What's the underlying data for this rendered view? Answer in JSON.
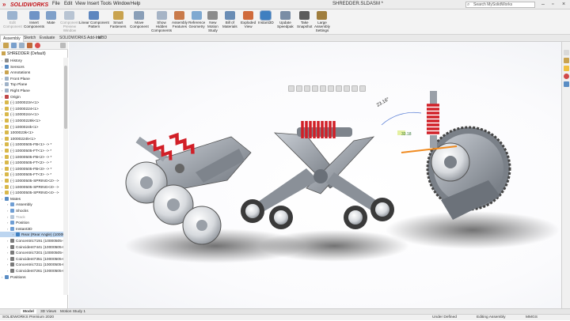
{
  "app": {
    "brand": "SOLIDWORKS",
    "doc_title": "SHREDDER.SLDASM *",
    "search_placeholder": "Search MySolidWorks"
  },
  "menu": [
    "File",
    "Edit",
    "View",
    "Insert",
    "Tools",
    "Window",
    "Help"
  ],
  "toolbar": [
    {
      "label": "Edit\nComponent",
      "dim": true,
      "color": "#9bb3cf"
    },
    {
      "label": "Insert\nComponents",
      "color": "#6f93c6"
    },
    {
      "label": "Mate",
      "color": "#7fa0c9"
    },
    {
      "label": "Component\nPreview\nWindow",
      "dim": true,
      "color": "#b8c4d3"
    },
    {
      "label": "Linear Component\nPattern",
      "color": "#5d86bf"
    },
    {
      "label": "Smart\nFasteners",
      "color": "#c9a34f"
    },
    {
      "label": "Move\nComponent",
      "color": "#8a9fb8"
    },
    {
      "label": "Show\nHidden\nComponents",
      "color": "#a6b4c6"
    },
    {
      "label": "Assembly\nFeatures",
      "color": "#c97a4a"
    },
    {
      "label": "Reference\nGeometry",
      "color": "#7fa9d1"
    },
    {
      "label": "New\nMotion\nStudy",
      "color": "#8c8c8c"
    },
    {
      "label": "Bill of\nMaterials",
      "color": "#6a8db5"
    },
    {
      "label": "Exploded\nView",
      "color": "#d06b3c"
    },
    {
      "label": "Instant3D",
      "active": true,
      "color": "#3f7fc0"
    },
    {
      "label": "Update\nSpeedpak",
      "color": "#7a8da5"
    },
    {
      "label": "Take\nSnapshot",
      "color": "#5c5c5c"
    },
    {
      "label": "Large\nAssembly\nSettings",
      "color": "#a07e3e"
    }
  ],
  "tabs": [
    "Assembly",
    "Sketch",
    "Evaluate",
    "SOLIDWORKS Add-Ins",
    "MBD"
  ],
  "tree": {
    "root": "SHREDDER (Default)",
    "items": [
      {
        "label": "History",
        "depth": 1,
        "icon": "#8c8c8c"
      },
      {
        "label": "Sensors",
        "depth": 1,
        "icon": "#5a8dc4"
      },
      {
        "label": "Annotations",
        "depth": 1,
        "icon": "#c9a34f"
      },
      {
        "label": "Front Plane",
        "depth": 1,
        "icon": "#9fb2c8"
      },
      {
        "label": "Top Plane",
        "depth": 1,
        "icon": "#9fb2c8"
      },
      {
        "label": "Right Plane",
        "depth": 1,
        "icon": "#9fb2c8"
      },
      {
        "label": "Origin",
        "depth": 1,
        "icon": "#c14848"
      },
      {
        "label": "(-) 1000023A<1>",
        "depth": 1,
        "icon": "#d9b84a"
      },
      {
        "label": "(-) 10000224<1>",
        "depth": 1,
        "icon": "#d9b84a"
      },
      {
        "label": "(-) 1000024A<1>",
        "depth": 1,
        "icon": "#d9b84a"
      },
      {
        "label": "(-) 10000228k<1>",
        "depth": 1,
        "icon": "#d9b84a"
      },
      {
        "label": "(-) 1000024k<1>",
        "depth": 1,
        "icon": "#d9b84a"
      },
      {
        "label": "1000023k<1>",
        "depth": 1,
        "icon": "#d9b84a"
      },
      {
        "label": "10000224k<1>",
        "depth": 1,
        "icon": "#d9b84a"
      },
      {
        "label": "(-) 10000505-FB<1> -> *",
        "depth": 1,
        "icon": "#d9b84a"
      },
      {
        "label": "(-) 10000505-FT<1> -> *",
        "depth": 1,
        "icon": "#d9b84a"
      },
      {
        "label": "(-) 10000505-FB<2> -> *",
        "depth": 1,
        "icon": "#d9b84a"
      },
      {
        "label": "(-) 10000505-FT<2> -> *",
        "depth": 1,
        "icon": "#d9b84a"
      },
      {
        "label": "(-) 10000505-FB<3> -> *",
        "depth": 1,
        "icon": "#d9b84a"
      },
      {
        "label": "(-) 10000505-FT<3> -> *",
        "depth": 1,
        "icon": "#d9b84a"
      },
      {
        "label": "(-) 10000505-SPRING<2> ->",
        "depth": 1,
        "icon": "#d9b84a"
      },
      {
        "label": "(-) 10000505-SPRING<3> ->",
        "depth": 1,
        "icon": "#d9b84a"
      },
      {
        "label": "(-) 10000505-SPRING<4> ->",
        "depth": 1,
        "icon": "#d9b84a"
      },
      {
        "label": "Mates",
        "depth": 1,
        "icon": "#5a8dc4"
      },
      {
        "label": "Assembly",
        "depth": 2,
        "icon": "#6f9ed4"
      },
      {
        "label": "Shocks",
        "depth": 2,
        "icon": "#6f9ed4"
      },
      {
        "label": "Track",
        "depth": 2,
        "icon": "#b5c6d9",
        "dim": true
      },
      {
        "label": "Position",
        "depth": 2,
        "icon": "#6f9ed4"
      },
      {
        "label": "Instant3D",
        "depth": 2,
        "icon": "#6f9ed4"
      },
      {
        "label": "Rear (Rear Angle) (10000",
        "depth": 3,
        "icon": "#3f7fc0",
        "selected": true
      },
      {
        "label": "Concentric7191 (10000505-F",
        "depth": 2,
        "icon": "#7a7a7a"
      },
      {
        "label": "Coincident7441 (10000505-F",
        "depth": 2,
        "icon": "#7a7a7a"
      },
      {
        "label": "Concentric7201 (10000505-F",
        "depth": 2,
        "icon": "#7a7a7a"
      },
      {
        "label": "Coincident7351 (10000505-F",
        "depth": 2,
        "icon": "#7a7a7a"
      },
      {
        "label": "Concentric7211 (10000505-F",
        "depth": 2,
        "icon": "#7a7a7a"
      },
      {
        "label": "Coincident7261 (10000505-F",
        "depth": 2,
        "icon": "#7a7a7a"
      },
      {
        "label": "Positions",
        "depth": 1,
        "icon": "#5a8dc4"
      }
    ]
  },
  "graphics": {
    "angle_label": "23.16°",
    "dim_label": "33.18",
    "colors": {
      "spring": "#d11f27",
      "frame": "#9aa0a8",
      "wheel": "#e4e6ea",
      "tire": "#3a3a3a"
    }
  },
  "bottom_tabs": [
    "Model",
    "3D Views",
    "Motion Study 1"
  ],
  "status": {
    "left": "SOLIDWORKS Premium 2020",
    "state": "Under Defined",
    "mode": "Editing Assembly",
    "units": "MMGS"
  }
}
